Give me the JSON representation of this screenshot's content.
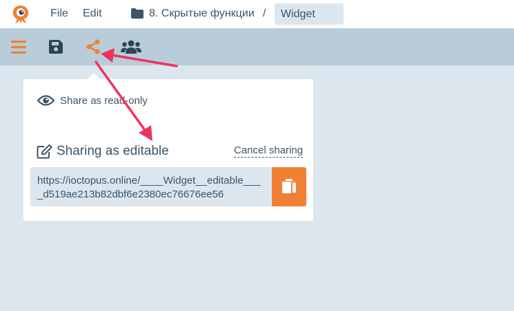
{
  "menubar": {
    "file_label": "File",
    "edit_label": "Edit",
    "folder_name": "8. Скрытые функции",
    "separator": "/",
    "document_title": "Widget"
  },
  "toolbar": {
    "icons": [
      "hamburger-menu-icon",
      "save-icon",
      "share-icon",
      "users-icon"
    ],
    "active_color": "#f08033"
  },
  "share_popover": {
    "readonly_label": "Share as read-only",
    "editable_label": "Sharing as editable",
    "cancel_label": "Cancel sharing",
    "url": "https://ioctopus.online/____Widget__editable____d519ae213b82dbf6e2380ec76676ee56"
  },
  "colors": {
    "accent": "#f08033",
    "text": "#3d5466",
    "annotation_arrow": "#ee3360"
  }
}
